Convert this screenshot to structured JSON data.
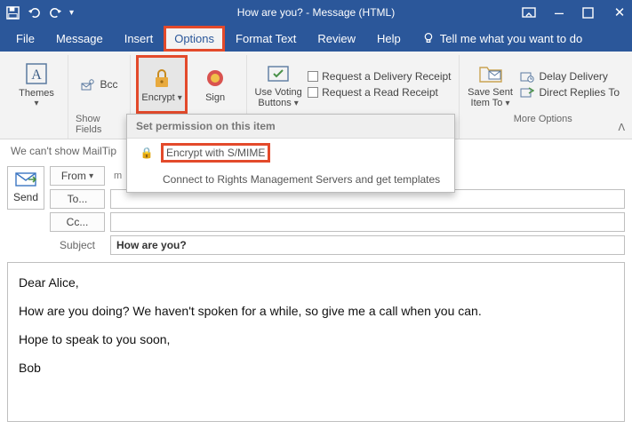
{
  "window": {
    "title": "How are you?  -  Message (HTML)"
  },
  "menus": {
    "file": "File",
    "message": "Message",
    "insert": "Insert",
    "options": "Options",
    "format": "Format Text",
    "review": "Review",
    "help": "Help",
    "tellme": "Tell me what you want to do"
  },
  "ribbon": {
    "themes": "Themes",
    "bcc": "Bcc",
    "show_fields": "Show Fields",
    "encrypt": "Encrypt",
    "sign": "Sign",
    "use_voting_line1": "Use Voting",
    "use_voting_line2": "Buttons",
    "delivery_receipt": "Request a Delivery Receipt",
    "read_receipt": "Request a Read Receipt",
    "save_sent_line1": "Save Sent",
    "save_sent_line2": "Item To",
    "delay_delivery": "Delay Delivery",
    "direct_replies": "Direct Replies To",
    "more_options": "More Options"
  },
  "dropdown": {
    "header": "Set permission on this item",
    "encrypt_smime": "Encrypt with S/MIME",
    "rms": "Connect to Rights Management Servers and get templates"
  },
  "mailtip": "We can't show MailTip",
  "compose": {
    "send": "Send",
    "from_label": "From",
    "from_meta": "m",
    "to_label": "To...",
    "cc_label": "Cc...",
    "subject_label": "Subject",
    "subject_value": "How are you?"
  },
  "body": {
    "p1": "Dear Alice,",
    "p2": "How are you doing? We haven't spoken for a while, so give me a call when you can.",
    "p3": "Hope to speak to you soon,",
    "p4": "Bob"
  }
}
